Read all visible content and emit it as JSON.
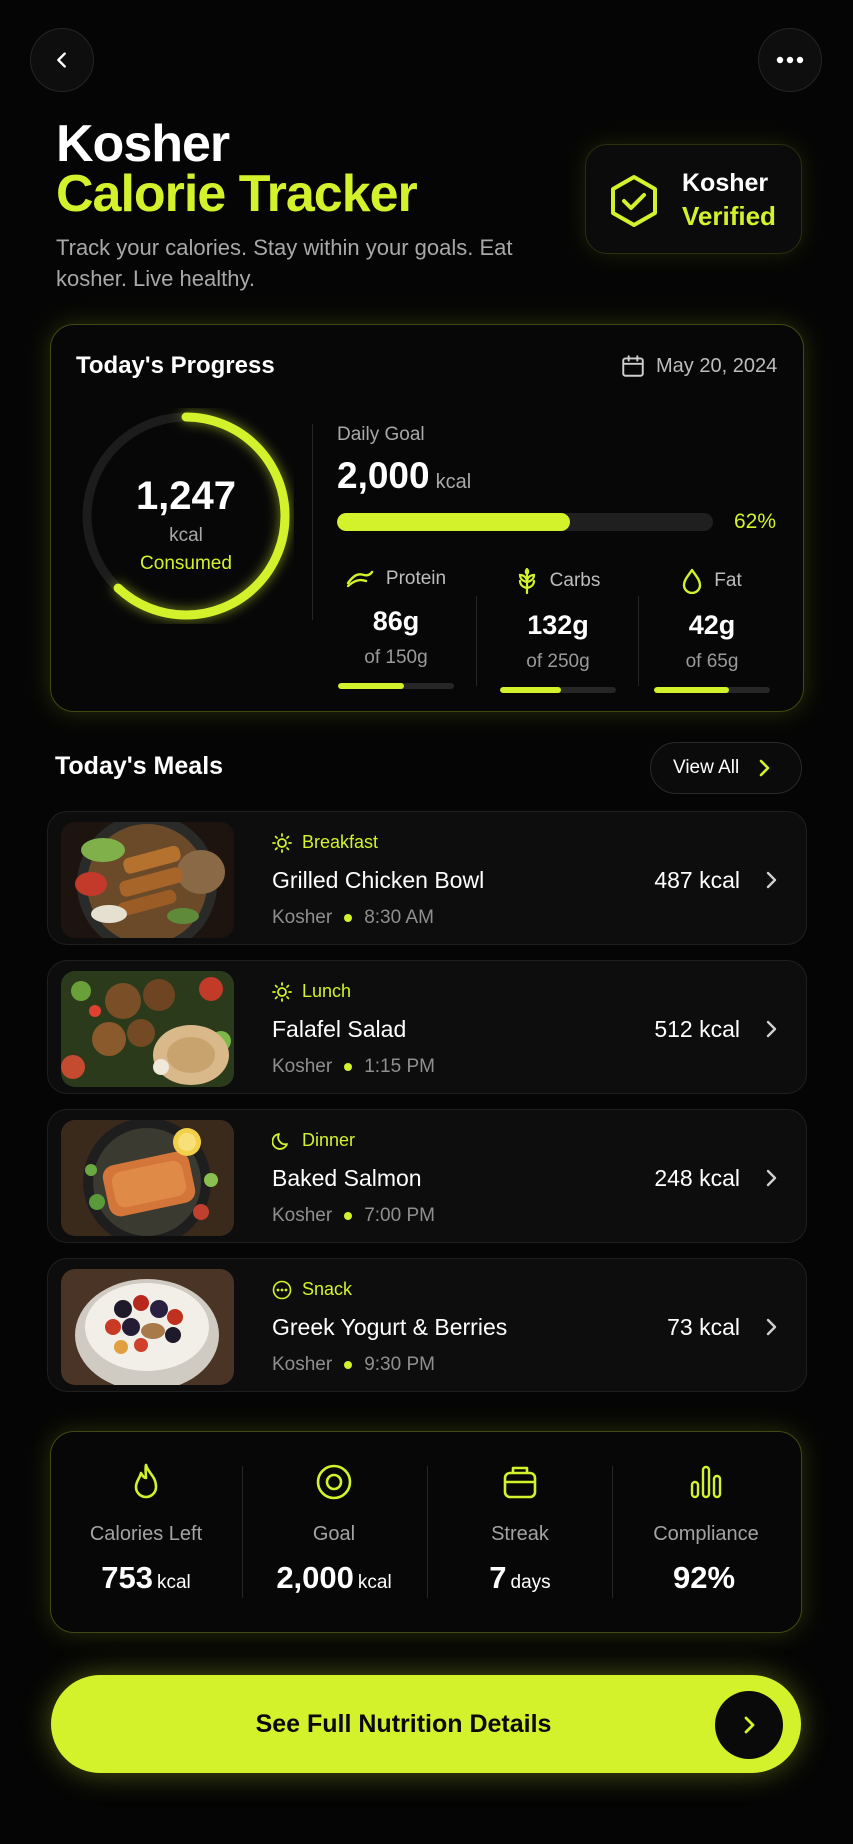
{
  "header": {
    "title_line1": "Kosher",
    "title_line2": "Calorie Tracker",
    "subtitle": "Track your calories. Stay within your goals. Eat kosher. Live healthy.",
    "back_icon": "chevron-left-icon",
    "more_icon": "more-horizontal-icon"
  },
  "badge": {
    "line1": "Kosher",
    "line2": "Verified",
    "icon": "shield-check-icon"
  },
  "progress": {
    "title": "Today's Progress",
    "date": "May 20, 2024",
    "consumed_value": "1,247",
    "consumed_unit": "kcal",
    "consumed_label": "Consumed",
    "ring_fraction": 0.62,
    "goal_label": "Daily Goal",
    "goal_value": "2,000",
    "goal_unit": "kcal",
    "goal_percent_text": "62%",
    "goal_fraction": 0.62,
    "macros": [
      {
        "name": "Protein",
        "icon": "protein-icon",
        "value": "86g",
        "of": "of 150g",
        "fraction": 0.57
      },
      {
        "name": "Carbs",
        "icon": "wheat-icon",
        "value": "132g",
        "of": "of 250g",
        "fraction": 0.53
      },
      {
        "name": "Fat",
        "icon": "droplet-icon",
        "value": "42g",
        "of": "of 65g",
        "fraction": 0.65
      }
    ]
  },
  "meals": {
    "title": "Today's Meals",
    "view_all": "View All",
    "items": [
      {
        "type": "Breakfast",
        "icon": "sun-icon",
        "name": "Grilled Chicken Bowl",
        "tag": "Kosher",
        "time": "8:30 AM",
        "kcal": "487 kcal"
      },
      {
        "type": "Lunch",
        "icon": "sun-icon",
        "name": "Falafel Salad",
        "tag": "Kosher",
        "time": "1:15 PM",
        "kcal": "512 kcal"
      },
      {
        "type": "Dinner",
        "icon": "moon-icon",
        "name": "Baked Salmon",
        "tag": "Kosher",
        "time": "7:00 PM",
        "kcal": "248 kcal"
      },
      {
        "type": "Snack",
        "icon": "dots-circle-icon",
        "name": "Greek Yogurt & Berries",
        "tag": "Kosher",
        "time": "9:30 PM",
        "kcal": "73 kcal"
      }
    ]
  },
  "stats": [
    {
      "label": "Calories Left",
      "icon": "flame-icon",
      "value": "753",
      "unit": "kcal"
    },
    {
      "label": "Goal",
      "icon": "target-icon",
      "value": "2,000",
      "unit": "kcal"
    },
    {
      "label": "Streak",
      "icon": "calendar-streak-icon",
      "value": "7",
      "unit": "days"
    },
    {
      "label": "Compliance",
      "icon": "bar-chart-icon",
      "value": "92%",
      "unit": ""
    }
  ],
  "cta": {
    "label": "See Full Nutrition Details"
  },
  "colors": {
    "accent": "#d4f22b",
    "background": "#050505",
    "card": "#0d0d0d"
  }
}
